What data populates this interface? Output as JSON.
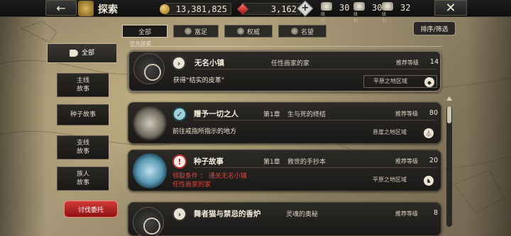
{
  "header": {
    "title": "探索",
    "back_icon": "arrow-left-icon",
    "close_icon": "close-x-icon",
    "gold": "13,381,825",
    "gems": "3,162",
    "tickets": [
      {
        "label": "级别",
        "value": "30"
      },
      {
        "label": "级别",
        "value": "30"
      },
      {
        "label": "级别",
        "value": "32"
      }
    ]
  },
  "filters": {
    "tabs": [
      "全部",
      "富足",
      "权威",
      "名望"
    ],
    "active": "全部",
    "sort_label": "排序/筛选"
  },
  "sidebar": {
    "items": [
      {
        "label": "全部",
        "active": true
      },
      {
        "label": "主线\n故事"
      },
      {
        "label": "种子故事"
      },
      {
        "label": "支线\n故事"
      },
      {
        "label": "族人\n故事"
      }
    ],
    "quest_button": "讨伐委托"
  },
  "section_label": "优先探索",
  "quests": [
    {
      "name": "无名小镇",
      "chapter": "",
      "subtitle": "任性画家的家",
      "rec_label": "推荐等级",
      "rec_level": "14",
      "desc": "获得“结实的皮革”",
      "region": "平原之地区域",
      "icon": "compass-icon"
    },
    {
      "name": "赠予一切之人",
      "chapter": "第1章",
      "subtitle": "生与死的终结",
      "rec_label": "推荐等级",
      "rec_level": "80",
      "desc": "前往戒指所指示的地方",
      "region": "悬崖之地区域",
      "icon": "idol-icon"
    },
    {
      "name": "种子故事",
      "chapter": "第1章",
      "subtitle": "救世的手抄本",
      "rec_label": "推荐等级",
      "rec_level": "20",
      "desc_line1": "领取条件 ： 通关无名小镇",
      "desc_line2": "任性画家的家",
      "region": "平原之地区域",
      "icon": "seal-icon"
    },
    {
      "name": "舞者猫与禁忌的香炉",
      "chapter": "",
      "subtitle": "灵魂的奥秘",
      "rec_label": "推荐等级",
      "rec_level": "8",
      "icon": "compass-icon"
    }
  ]
}
